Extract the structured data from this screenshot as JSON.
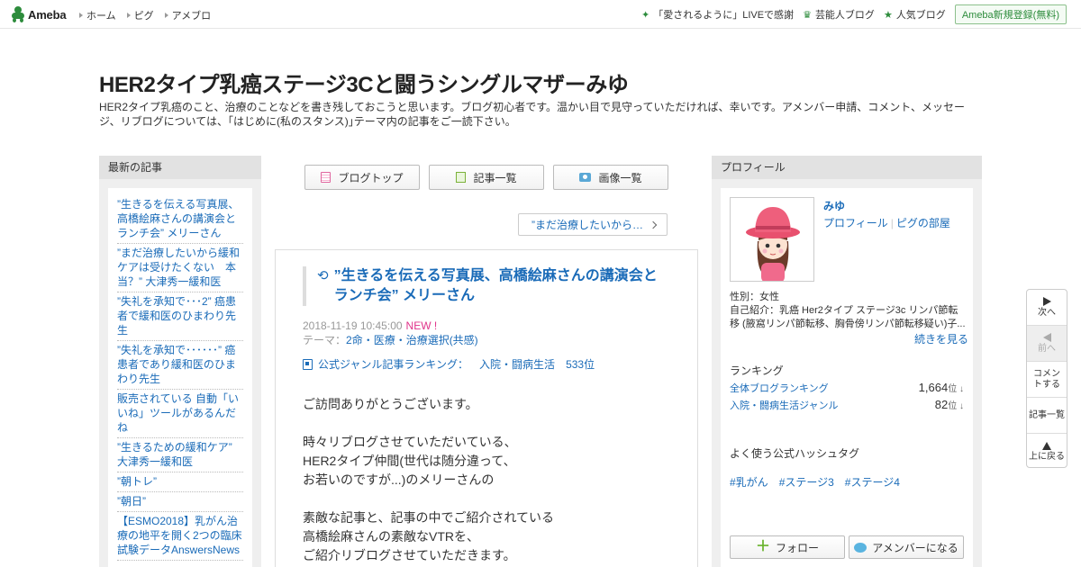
{
  "topbar": {
    "logo_text": "Ameba",
    "nav": [
      "ホーム",
      "ピグ",
      "アメブロ"
    ],
    "right_links": [
      {
        "label": "「愛されるように」LIVEで感謝",
        "icon": "sparkle-icon"
      },
      {
        "label": "芸能人ブログ",
        "icon": "crown-icon"
      },
      {
        "label": "人気ブログ",
        "icon": "star-icon"
      }
    ],
    "register_label": "Ameba新規登録(無料)"
  },
  "header": {
    "title": "HER2タイプ乳癌ステージ3Cと闘うシングルマザーみゆ",
    "description": "HER2タイプ乳癌のこと、治療のことなどを書き残しておこうと思います。ブログ初心者です。温かい目で見守っていただければ、幸いです。アメンバー申請、コメント、メッセージ、リブログについては、｢はじめに(私のスタンス)｣テーマ内の記事をご一読下さい。"
  },
  "left_sidebar": {
    "heading": "最新の記事",
    "articles": [
      "”生きるを伝える写真展、高橋絵麻さんの講演会とランチ会” メリーさん",
      "”まだ治療したいから緩和ケアは受けたくない　本当？” 大津秀一緩和医",
      "”失礼を承知で･･･2” 癌患者で緩和医のひまわり先生",
      "”失礼を承知で･･････” 癌患者であり緩和医のひまわり先生",
      "販売されている 自動「いいね」ツールがあるんだね",
      "”生きるための緩和ケア” 大津秀一緩和医",
      "”朝トレ”",
      "”朝日”",
      "【ESMO2018】乳がん治療の地平を開く2つの臨床試験データAnswersNews"
    ]
  },
  "center": {
    "tabs": [
      "ブログトップ",
      "記事一覧",
      "画像一覧"
    ],
    "next_article": "”まだ治療したいから…",
    "article": {
      "title": "”生きるを伝える写真展、高橋絵麻さんの講演会とランチ会” メリーさん",
      "date": "2018-11-19 10:45:00",
      "new_badge": "NEW !",
      "theme_prefix": "テーマ：",
      "theme": "2命・医療・治療選択(共感)",
      "ranking_label": "公式ジャンル記事ランキング：",
      "ranking_genre": "入院・闘病生活",
      "ranking_value": "533位",
      "body": [
        "ご訪問ありがとうございます。",
        "",
        "時々リブログさせていただいている、",
        "HER2タイプ仲間(世代は随分違って、",
        "お若いのですが...)のメリーさんの",
        "",
        "素敵な記事と、記事の中でご紹介されている",
        "高橋絵麻さんの素敵なVTRを、",
        "ご紹介リブログさせていただきます。"
      ]
    }
  },
  "right_sidebar": {
    "heading": "プロフィール",
    "name": "みゆ",
    "link_profile": "プロフィール",
    "link_pigg": "ピグの部屋",
    "gender": "性別：女性",
    "intro": "自己紹介：乳癌 Her2タイプ ステージ3c リンパ節転移 (腋窩リンパ節転移、胸骨傍リンパ節転移疑い)子...",
    "more": "続きを見る",
    "ranking_heading": "ランキング",
    "rankings": [
      {
        "label": "全体ブログランキング",
        "value": "1,664",
        "unit": "位 ↓"
      },
      {
        "label": "入院・闘病生活ジャンル",
        "value": "82",
        "unit": "位 ↓"
      }
    ],
    "hashtag_heading": "よく使う公式ハッシュタグ",
    "hashtags": [
      "#乳がん",
      "#ステージ3",
      "#ステージ4"
    ],
    "follow_label": "フォロー",
    "amember_label": "アメンバーになる"
  },
  "float_nav": {
    "next": "次へ",
    "prev": "前へ",
    "comment": "コメントする",
    "list": "記事一覧",
    "top": "上に戻る"
  }
}
